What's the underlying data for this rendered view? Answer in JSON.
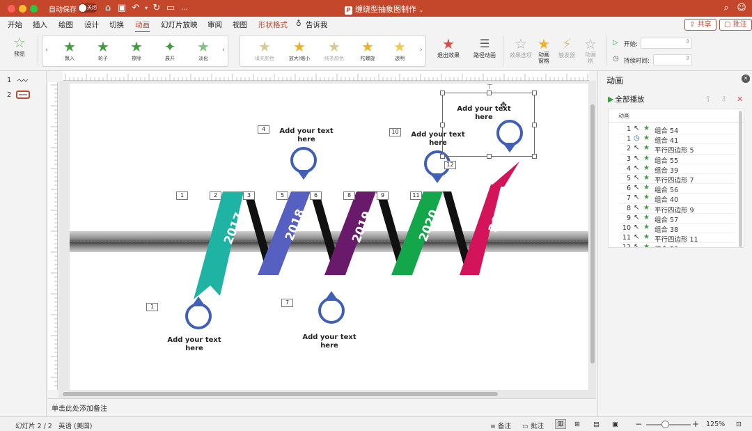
{
  "window": {
    "autosave_label": "自动保存",
    "autosave_state": "关闭",
    "doc_title": "缠绕型抽象图制作",
    "app_badge": "P"
  },
  "tabs": [
    "开始",
    "插入",
    "绘图",
    "设计",
    "切换",
    "动画",
    "幻灯片放映",
    "审阅",
    "视图",
    "形状格式",
    "告诉我"
  ],
  "active_tab": "动画",
  "share_label": "共享",
  "comment_label": "批注",
  "ribbon": {
    "preview_label": "预览",
    "effects_entry": [
      "飘入",
      "轮子",
      "擦除",
      "展开",
      "淡化"
    ],
    "effects_emphasis": [
      "填充颜色",
      "放大/缩小",
      "线条颜色",
      "陀螺旋",
      "透明"
    ],
    "exit_label": "退出效果",
    "path_label": "路径动画",
    "options_label": "效果选项",
    "pane_label_1": "动画",
    "pane_label_2": "窗格",
    "trigger_label": "触发器",
    "painter_label_1": "动画",
    "painter_label_2": "刷",
    "start_label": "开始:",
    "duration_label": "持续时间:"
  },
  "thumbnails": [
    "1",
    "2"
  ],
  "slide": {
    "years": [
      "2017",
      "2018",
      "2019",
      "2020",
      "2021"
    ],
    "placeholder_line1": "Add your text",
    "placeholder_line2": "here",
    "tags": [
      "1",
      "2",
      "3",
      "4",
      "5",
      "6",
      "7",
      "8",
      "9",
      "10",
      "11",
      "12",
      "1"
    ]
  },
  "notes_placeholder": "单击此处添加备注",
  "animation_pane": {
    "title": "动画",
    "play_all": "全部播放",
    "column_header": "动画",
    "items": [
      {
        "num": "1",
        "trigger": "click",
        "name": "组合 54"
      },
      {
        "num": "1",
        "trigger": "clock",
        "name": "组合 41"
      },
      {
        "num": "2",
        "trigger": "click",
        "name": "平行四边形 5"
      },
      {
        "num": "3",
        "trigger": "click",
        "name": "组合 55"
      },
      {
        "num": "4",
        "trigger": "click",
        "name": "组合 39"
      },
      {
        "num": "5",
        "trigger": "click",
        "name": "平行四边形 7"
      },
      {
        "num": "6",
        "trigger": "click",
        "name": "组合 56"
      },
      {
        "num": "7",
        "trigger": "click",
        "name": "组合 40"
      },
      {
        "num": "8",
        "trigger": "click",
        "name": "平行四边形 9"
      },
      {
        "num": "9",
        "trigger": "click",
        "name": "组合 57"
      },
      {
        "num": "10",
        "trigger": "click",
        "name": "组合 38"
      },
      {
        "num": "11",
        "trigger": "click",
        "name": "平行四边形 11"
      },
      {
        "num": "12",
        "trigger": "click",
        "name": "组合 58"
      }
    ]
  },
  "status": {
    "slide_info": "幻灯片 2 / 2",
    "language": "英语 (美国)",
    "notes_label": "备注",
    "comments_label": "批注",
    "zoom": "125%"
  },
  "colors": {
    "accent": "#c4472c",
    "ribbon_2017": "#1fb3a3",
    "ribbon_2018": "#5560c0",
    "ribbon_2019": "#6a1a6a",
    "ribbon_2020": "#14a64a",
    "ribbon_2021": "#d4145a",
    "pin": "#3f5fb8"
  }
}
